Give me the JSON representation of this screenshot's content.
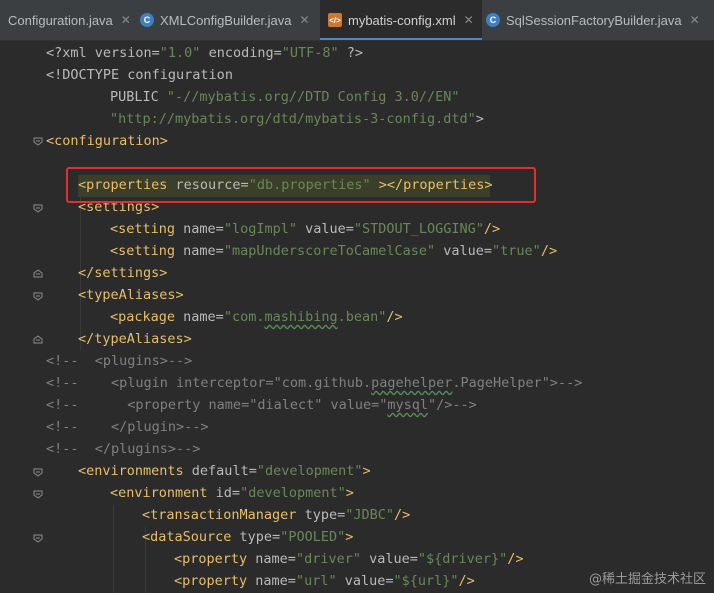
{
  "tabs": [
    {
      "label": "Configuration.java",
      "icon": "C",
      "active": false
    },
    {
      "label": "XMLConfigBuilder.java",
      "icon": "C",
      "active": false
    },
    {
      "label": "mybatis-config.xml",
      "icon": "xml",
      "active": true
    },
    {
      "label": "SqlSessionFactoryBuilder.java",
      "icon": "C",
      "active": false
    }
  ],
  "code": {
    "l1": {
      "p1": "<?xml version=",
      "v1": "\"1.0\"",
      "p2": " encoding=",
      "v2": "\"UTF-8\"",
      "p3": " ?>"
    },
    "l2": {
      "p1": "<!DOCTYPE ",
      "p2": "configuration"
    },
    "l3": {
      "p1": "PUBLIC ",
      "v1": "\"-//mybatis.org//DTD Config 3.0//EN\""
    },
    "l4": {
      "v1": "\"http://mybatis.org/dtd/mybatis-3-config.dtd\"",
      "p1": ">"
    },
    "l5": {
      "t1": "<configuration>"
    },
    "l7": {
      "t1": "<properties",
      "a1": " resource=",
      "v1": "\"db.properties\"",
      "t2": " ></properties>"
    },
    "l8": {
      "t1": "<settings>"
    },
    "l9": {
      "t1": "<setting",
      "a1": " name=",
      "v1": "\"logImpl\"",
      "a2": " value=",
      "v2": "\"STDOUT_LOGGING\"",
      "t2": "/>"
    },
    "l10": {
      "t1": "<setting",
      "a1": " name=",
      "v1": "\"mapUnderscoreToCamelCase\"",
      "a2": " value=",
      "v2": "\"true\"",
      "t2": "/>"
    },
    "l11": {
      "t1": "</settings>"
    },
    "l12": {
      "t1": "<typeAliases>"
    },
    "l13": {
      "t1": "<package",
      "a1": " name=",
      "v1a": "\"com.",
      "v1b": "mashibing",
      "v1c": ".bean\"",
      "t2": "/>"
    },
    "l14": {
      "t1": "</typeAliases>"
    },
    "l15": {
      "c1": "<!--  <plugins>-->"
    },
    "l16": {
      "c1": "<!--    <plugin interceptor=\"com.github.",
      "c2": "pagehelper",
      "c3": ".PageHelper\">-->"
    },
    "l17": {
      "c1": "<!--      <property name=\"dialect\" value=\"",
      "c2": "mysql",
      "c3": "\"/>-->"
    },
    "l18": {
      "c1": "<!--    </plugin>-->"
    },
    "l19": {
      "c1": "<!--  </plugins>-->"
    },
    "l20": {
      "t1": "<environments",
      "a1": " default=",
      "v1": "\"development\"",
      "t2": ">"
    },
    "l21": {
      "t1": "<environment",
      "a1": " id=",
      "v1": "\"development\"",
      "t2": ">"
    },
    "l22": {
      "t1": "<transactionManager",
      "a1": " type=",
      "v1": "\"JDBC\"",
      "t2": "/>"
    },
    "l23": {
      "t1": "<dataSource",
      "a1": " type=",
      "v1": "\"POOLED\"",
      "t2": ">"
    },
    "l24": {
      "t1": "<property",
      "a1": " name=",
      "v1": "\"driver\"",
      "a2": " value=",
      "v2": "\"${driver}\"",
      "t2": "/>"
    },
    "l25": {
      "t1": "<property",
      "a1": " name=",
      "v1": "\"url\"",
      "a2": " value=",
      "v2": "\"${url}\"",
      "t2": "/>"
    }
  },
  "watermark": "@稀土掘金技术社区",
  "colors": {
    "tag": "#e8bf6a",
    "attr": "#bababa",
    "value": "#6a8759",
    "comment": "#808080",
    "highlight_box": "#e0302d"
  }
}
